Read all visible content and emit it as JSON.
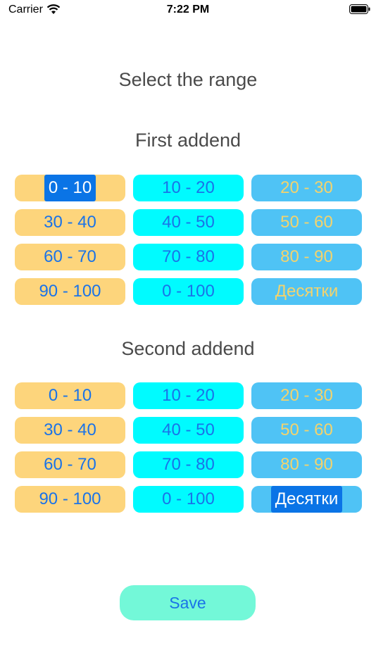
{
  "status_bar": {
    "carrier": "Carrier",
    "time": "7:22 PM"
  },
  "title": "Select the range",
  "first": {
    "heading": "First addend",
    "options": [
      "0 - 10",
      "10 - 20",
      "20 - 30",
      "30 - 40",
      "40 - 50",
      "50 - 60",
      "60 - 70",
      "70 - 80",
      "80 - 90",
      "90 - 100",
      "0 - 100",
      "Десятки"
    ],
    "selected": "0 - 10"
  },
  "second": {
    "heading": "Second addend",
    "options": [
      "0 - 10",
      "10 - 20",
      "20 - 30",
      "30 - 40",
      "40 - 50",
      "50 - 60",
      "60 - 70",
      "70 - 80",
      "80 - 90",
      "90 - 100",
      "0 - 100",
      "Десятки"
    ],
    "selected": "Десятки"
  },
  "save_label": "Save",
  "colors": {
    "column_1": "#fdd57c",
    "column_2": "#00fbff",
    "column_3": "#4fc3f5",
    "selected": "#0a74e6",
    "save": "#73f8d8",
    "label": "#1a73e8"
  }
}
